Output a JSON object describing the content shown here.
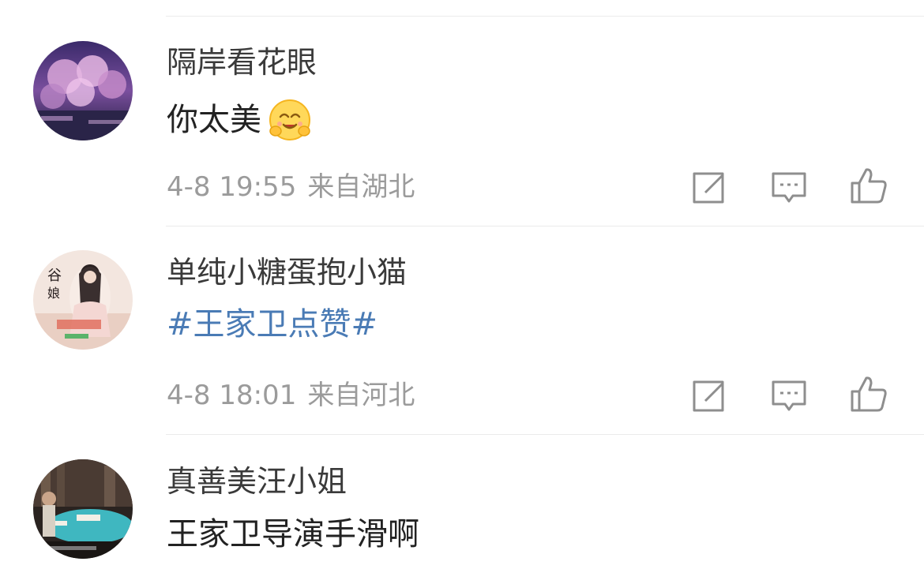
{
  "comments": [
    {
      "username": "隔岸看花眼",
      "text": "你太美",
      "emoji": "hugging-face-emoji",
      "time": "4-8 19:55",
      "location": "来自湖北",
      "avatar": "cherry-blossom-night-photo"
    },
    {
      "username": "单纯小糖蛋抱小猫",
      "text": "#王家卫点赞#",
      "time": "4-8 18:01",
      "location": "来自河北",
      "avatar": "drama-poster-photo"
    },
    {
      "username": "真善美汪小姐",
      "text": "王家卫导演手滑啊",
      "avatar": "mahjong-scene-photo"
    }
  ],
  "actions": {
    "icons": [
      "share-icon",
      "comment-icon",
      "like-icon"
    ]
  },
  "colors": {
    "hashtag": "#4a7bb5",
    "meta": "#9b9b9b",
    "icon": "#8e8e8e",
    "divider": "#ebebeb"
  }
}
